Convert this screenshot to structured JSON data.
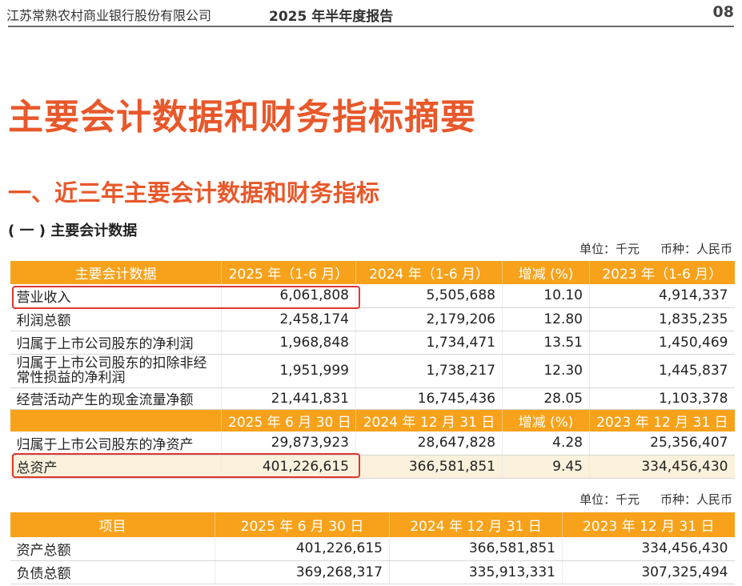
{
  "header": {
    "company": "江苏常熟农村商业银行股份有限公司",
    "report": "2025 年半年度报告",
    "page": "08"
  },
  "titles": {
    "main": "主要会计数据和财务指标摘要",
    "section": "一、近三年主要会计数据和财务指标",
    "subsection": "( 一 ) 主要会计数据"
  },
  "unit_note": {
    "unit": "单位：千元",
    "currency": "币种：人民币"
  },
  "table1": {
    "headers": [
      "主要会计数据",
      "2025 年（1-6 月）",
      "2024 年（1-6 月）",
      "增减 (%)",
      "2023 年（1-6 月）"
    ],
    "rows": [
      [
        "营业收入",
        "6,061,808",
        "5,505,688",
        "10.10",
        "4,914,337"
      ],
      [
        "利润总额",
        "2,458,174",
        "2,179,206",
        "12.80",
        "1,835,235"
      ],
      [
        "归属于上市公司股东的净利润",
        "1,968,848",
        "1,734,471",
        "13.51",
        "1,450,469"
      ],
      [
        "归属于上市公司股东的扣除非经常性损益的净利润",
        "1,951,999",
        "1,738,217",
        "12.30",
        "1,445,837"
      ],
      [
        "经营活动产生的现金流量净额",
        "21,441,831",
        "16,745,436",
        "28.05",
        "1,103,378"
      ]
    ],
    "headers2": [
      "",
      "2025 年 6 月 30 日",
      "2024 年 12 月 31 日",
      "增减 (%)",
      "2023 年 12 月 31 日"
    ],
    "rows2": [
      [
        "归属于上市公司股东的净资产",
        "29,873,923",
        "28,647,828",
        "4.28",
        "25,356,407"
      ],
      [
        "总资产",
        "401,226,615",
        "366,581,851",
        "9.45",
        "334,456,430"
      ]
    ]
  },
  "table2": {
    "headers": [
      "项目",
      "2025 年 6 月 30 日",
      "2024 年 12 月 31 日",
      "2023 年 12 月 31 日"
    ],
    "rows": [
      [
        "资产总额",
        "401,226,615",
        "366,581,851",
        "334,456,430"
      ],
      [
        "负债总额",
        "369,268,317",
        "335,913,331",
        "307,325,494"
      ]
    ]
  },
  "colors": {
    "accent_title": "#e8582a",
    "header_fill": "#f7a21a",
    "highlight_box": "#e0362f",
    "beige_row": "#fbf1dc"
  }
}
